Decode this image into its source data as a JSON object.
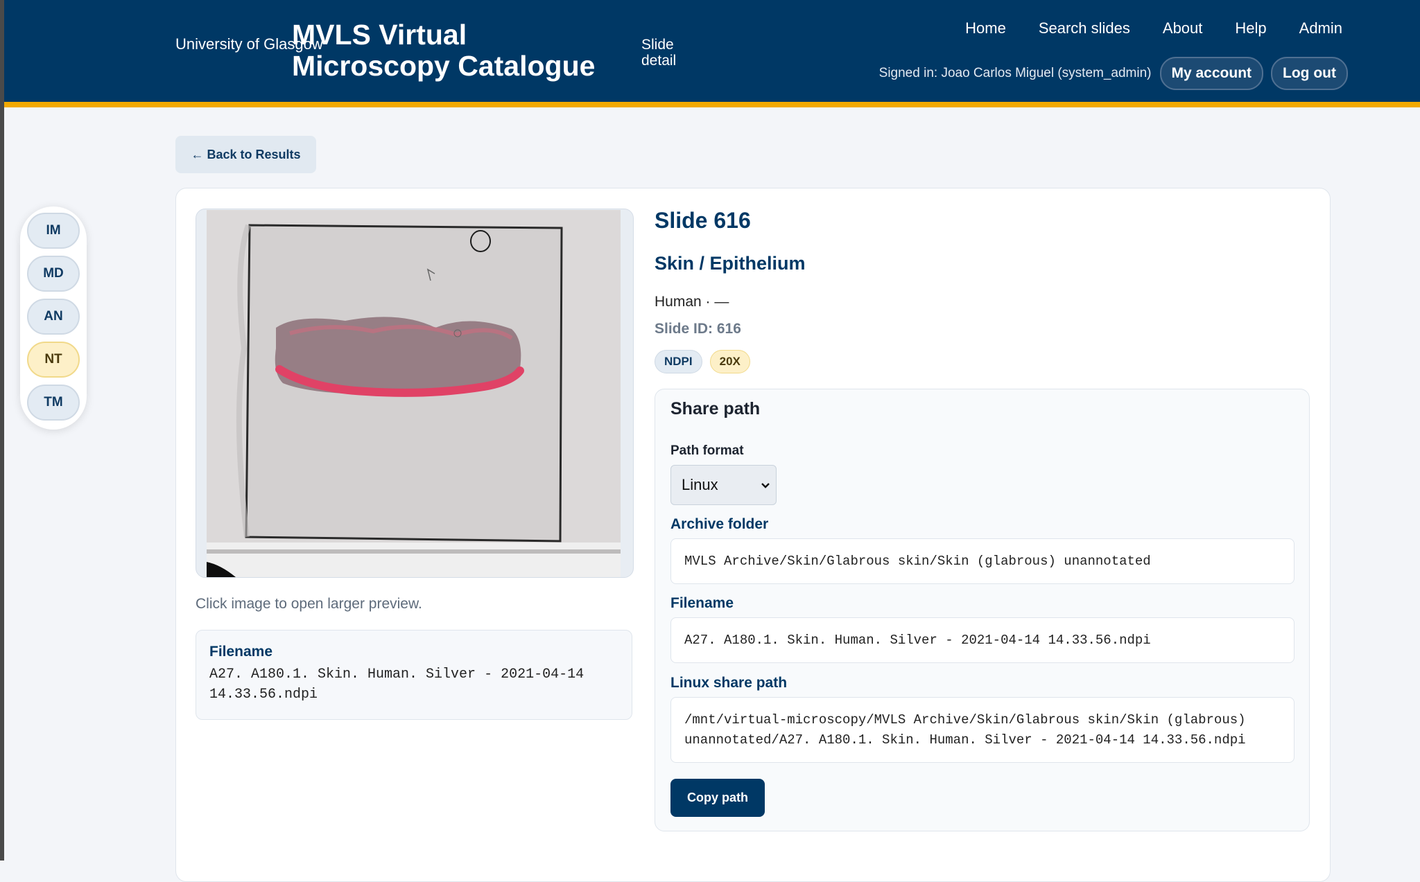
{
  "header": {
    "university": "University of Glasgow",
    "app_title_line1": "MVLS Virtual",
    "app_title_line2": "Microscopy Catalogue",
    "breadcrumb_line1": "Slide",
    "breadcrumb_line2": "detail",
    "nav": [
      "Home",
      "Search slides",
      "About",
      "Help",
      "Admin"
    ],
    "signed_in": "Signed in: Joao Carlos Miguel (system_admin)",
    "my_account": "My account",
    "log_out": "Log out"
  },
  "rail": {
    "items": [
      {
        "label": "IM",
        "active": false
      },
      {
        "label": "MD",
        "active": false
      },
      {
        "label": "AN",
        "active": false
      },
      {
        "label": "NT",
        "active": true
      },
      {
        "label": "TM",
        "active": false
      }
    ]
  },
  "back_button": "← Back to Results",
  "preview": {
    "hint": "Click image to open larger preview.",
    "filename_label": "Filename",
    "filename_line1": "A27. A180.1. Skin. Human. Silver - 2021-04-14",
    "filename_line2": "14.33.56.ndpi"
  },
  "slide": {
    "title": "Slide 616",
    "subtitle": "Skin / Epithelium",
    "species": "Human · —",
    "slide_id": "Slide ID: 616",
    "badges": [
      "NDPI",
      "20X"
    ]
  },
  "share": {
    "heading": "Share path",
    "path_format_label": "Path format",
    "path_format_value": "Linux",
    "archive_label": "Archive folder",
    "archive_value": "MVLS Archive/Skin/Glabrous skin/Skin (glabrous) unannotated",
    "filename_label": "Filename",
    "filename_value": "A27. A180.1. Skin. Human. Silver - 2021-04-14 14.33.56.ndpi",
    "linux_label": "Linux share path",
    "linux_line1": "/mnt/virtual-microscopy/MVLS Archive/Skin/Glabrous skin/Skin (glabrous)",
    "linux_line2": "unannotated/A27. A180.1. Skin. Human. Silver - 2021-04-14 14.33.56.ndpi",
    "copy_button": "Copy path"
  },
  "colors": {
    "brand_navy": "#003865",
    "accent_gold": "#f2a900",
    "tissue_pink": "#d94a66"
  },
  "icons": [
    "chevron-down-icon",
    "slide-thumbnail-image"
  ]
}
